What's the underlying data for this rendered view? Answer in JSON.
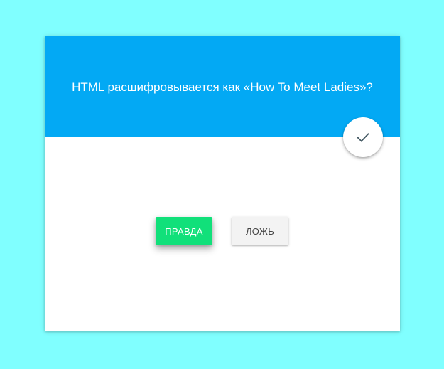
{
  "question": {
    "text": "HTML расшифровывается как «How To Meet Ladies»?"
  },
  "answers": {
    "true_label": "ПРАВДА",
    "false_label": "ЛОЖЬ"
  },
  "icons": {
    "check": "check-icon"
  },
  "colors": {
    "page_background": "#80ffff",
    "header_background": "#03a9f4",
    "true_button": "#11e07a",
    "false_button": "#f3f3f3",
    "check_icon": "#455a64"
  }
}
